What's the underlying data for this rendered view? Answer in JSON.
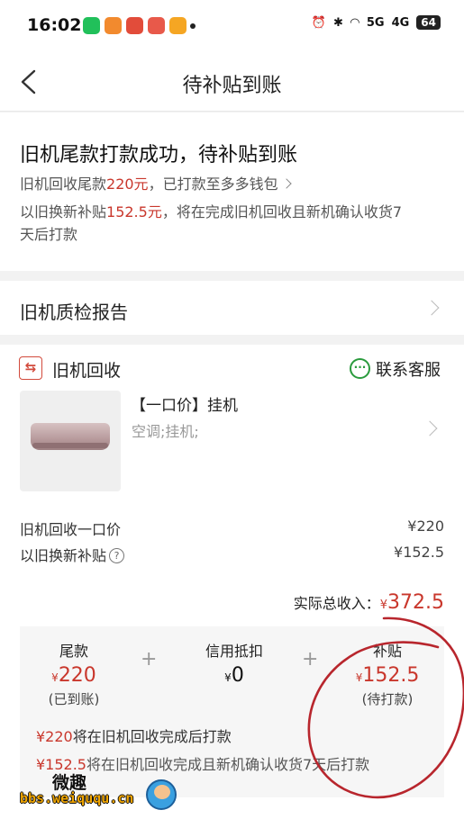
{
  "status_bar": {
    "time": "16:02",
    "signal_5g": "5G",
    "signal_4g": "4G",
    "battery": "64"
  },
  "nav": {
    "title": "待补贴到账"
  },
  "summary": {
    "title": "旧机尾款打款成功，待补贴到账",
    "line1_prefix": "旧机回收尾款",
    "line1_amount": "220元",
    "line1_suffix": "，已打款至多多钱包",
    "line2_prefix": "以旧换新补贴",
    "line2_amount": "152.5元",
    "line2_suffix": "，将在完成旧机回收且新机确认收货7",
    "line3": "天后打款"
  },
  "report": {
    "label": "旧机质检报告"
  },
  "recycle": {
    "section_label": "旧机回收",
    "contact_label": "联系客服",
    "product_name": "【一口价】挂机",
    "product_spec": "空调;挂机;"
  },
  "prices": {
    "rows": [
      {
        "label": "旧机回收一口价",
        "value": "¥220"
      },
      {
        "label": "以旧换新补贴",
        "value": "¥152.5"
      }
    ],
    "total_label": "实际总收入：",
    "total_currency": "¥",
    "total_value": "372.5"
  },
  "breakdown": {
    "cols": [
      {
        "title": "尾款",
        "currency": "¥",
        "value": "220",
        "status": "(已到账)"
      },
      {
        "title": "信用抵扣",
        "currency": "¥",
        "value": "0",
        "status": ""
      },
      {
        "title": "补贴",
        "currency": "¥",
        "value": "152.5",
        "status": "(待打款)"
      }
    ],
    "plus": "+",
    "notes": [
      {
        "amount": "¥220",
        "text": "将在旧机回收完成后打款"
      },
      {
        "amount": "¥152.5",
        "text": "将在旧机回收完成且新机确认收货7天后打款"
      }
    ]
  },
  "watermark": {
    "top": "微趣",
    "url": "bbs.weiququ.cn"
  },
  "colors": {
    "accent_red": "#c9372c",
    "support_green": "#2a9b3d",
    "annotation_red": "#b8262d"
  },
  "icons": [
    "back-arrow-icon",
    "chevron-right-icon",
    "recycle-icon",
    "chat-bubble-icon",
    "help-icon"
  ]
}
